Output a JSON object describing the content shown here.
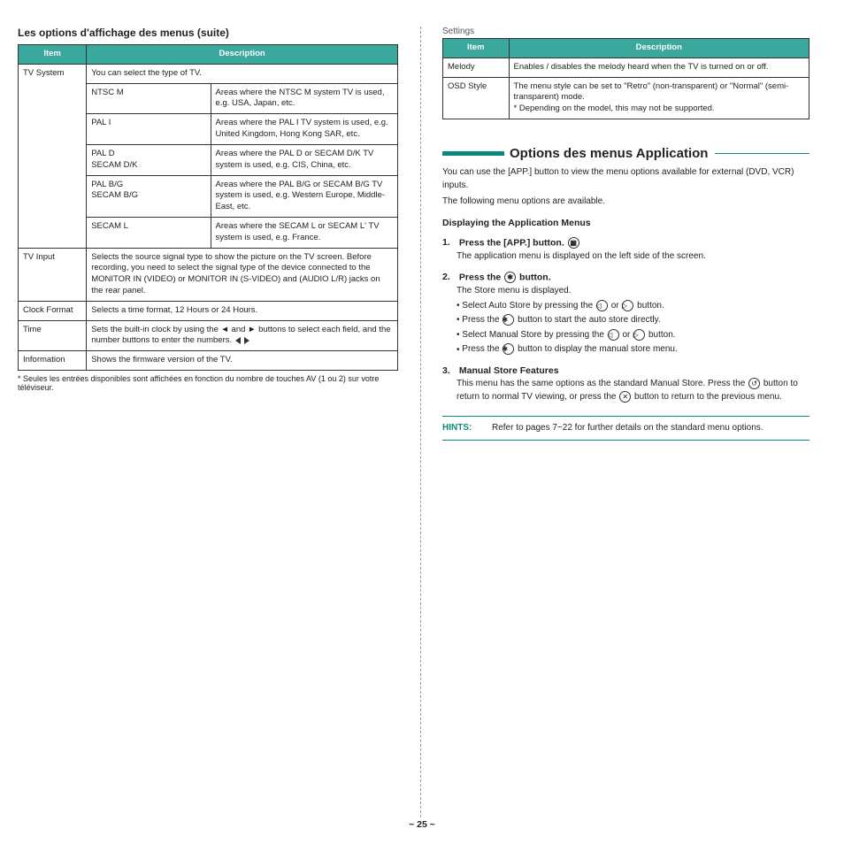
{
  "page_header_small": "Settings",
  "left": {
    "title": "Les options d'affichage des menus (suite)",
    "table": {
      "col_item": "Item",
      "col_desc": "Description",
      "rows": [
        {
          "item": "TV System",
          "desc": "You can select the type of TV.",
          "pairs": [
            {
              "k": "NTSC M",
              "v": "Areas where the NTSC M system TV is used, e.g. USA, Japan, etc."
            },
            {
              "k": "PAL I",
              "v": "Areas where the PAL I TV system is used, e.g. United Kingdom, Hong Kong SAR, etc."
            },
            {
              "k": "PAL D\nSECAM D/K",
              "v": "Areas where the PAL D or SECAM D/K TV system is used, e.g. CIS, China, etc."
            },
            {
              "k": "PAL B/G\nSECAM B/G",
              "v": "Areas where the PAL B/G or SECAM B/G TV system is used, e.g. Western Europe, Middle-East, etc."
            },
            {
              "k": "SECAM L",
              "v": "Areas where the SECAM L or SECAM L' TV system is used, e.g. France."
            }
          ]
        },
        {
          "item": "TV Input",
          "desc": "Selects the source signal type to show the picture on the TV screen. Before recording, you need to select the signal type of the device connected to the MONITOR IN (VIDEO) or MONITOR IN (S-VIDEO) and (AUDIO L/R) jacks on the rear panel."
        },
        {
          "item": "Clock Format",
          "desc": "Selects a time format, 12 Hours or 24 Hours."
        },
        {
          "item": "Time",
          "desc": "Sets the built-in clock by using the ◄ and ► buttons to select each field, and the number buttons to enter the numbers."
        },
        {
          "item": "Information",
          "desc": "Shows the firmware version of the TV."
        }
      ]
    },
    "hint": "* Seules les entrées disponibles sont affichées en fonction du nombre de touches AV (1 ou 2) sur votre téléviseur."
  },
  "right": {
    "tbl2": {
      "col_item": "Item",
      "col_desc": "Description",
      "rows": [
        {
          "item": "Melody",
          "desc": "Enables / disables the melody heard when the TV is turned on or off."
        },
        {
          "item": "OSD Style",
          "desc": "The menu style can be set to \"Retro\" (non-transparent) or \"Normal\" (semi-transparent) mode.\n* Depending on the model, this may not be supported."
        }
      ]
    },
    "sect_title": "Options des menus Application",
    "intro1": "You can use the [APP.] button to view the menu options available for external (DVD, VCR) inputs.",
    "intro2": "The following menu options are available.",
    "steps_head": "Displaying the Application Menus",
    "step1": "Press the [APP.] button.",
    "step1b": "The application menu is displayed on the left side of the screen.",
    "step2": "Press the ",
    "step2b": " button.",
    "step2c": "The Store menu is displayed.",
    "bul1a": "Select Auto Store by pressing the ",
    "bul1b": " or ",
    "bul1c": " button.",
    "bul2a": "Press the ",
    "bul2b": " button to start the auto store directly.",
    "bul3a": "Select Manual Store by pressing the ",
    "bul3b": " or ",
    "bul3c": " button.",
    "bul4a": "Press the ",
    "bul4b": " button to display the manual store menu.",
    "step3": "Manual Store Features",
    "step3a": "This menu has the same options as the standard Manual Store. Press the ",
    "step3b": " button to return to normal TV viewing, or press the ",
    "step3c": " button to return to the previous menu.",
    "hints_label": "HINTS:",
    "hints_text": "Refer to pages 7~22 for further details on the standard menu options."
  },
  "page_number": "~ 25 ~"
}
